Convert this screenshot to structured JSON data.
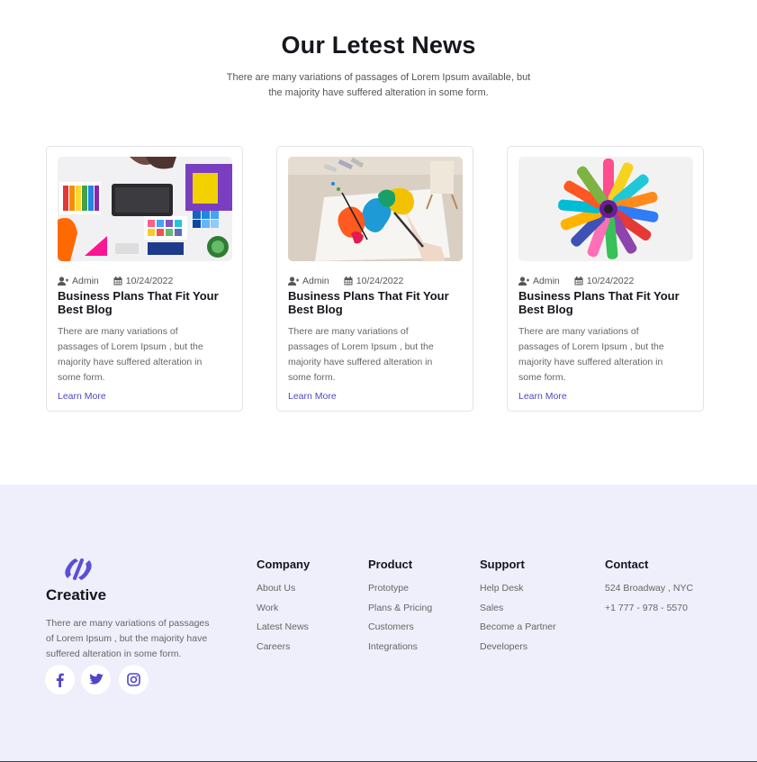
{
  "news": {
    "title": "Our Letest News",
    "subtitle": "There are many variations of passages of Lorem Ipsum available, but the majority have suffered alteration in some form."
  },
  "cards": [
    {
      "author": "Admin",
      "date": "10/24/2022",
      "title": "Business Plans That Fit Your Best Blog",
      "text": "There are many variations of passages of Lorem Ipsum , but the majority have suffered alteration in some form.",
      "link": "Learn More",
      "image": "design-desk-photo"
    },
    {
      "author": "Admin",
      "date": "10/24/2022",
      "title": "Business Plans That Fit Your Best Blog",
      "text": "There are many variations of passages of Lorem Ipsum , but the majority have suffered alteration in some form.",
      "link": "Learn More",
      "image": "painting-photo"
    },
    {
      "author": "Admin",
      "date": "10/24/2022",
      "title": "Business Plans That Fit Your Best Blog",
      "text": "There are many variations of passages of Lorem Ipsum , but the majority have suffered alteration in some form.",
      "link": "Learn More",
      "image": "markers-photo"
    }
  ],
  "footer": {
    "brand": {
      "name": "Creative",
      "text": "There are many variations of passages of Lorem Ipsum , but the majority have suffered alteration in some form."
    },
    "social": [
      "facebook-icon",
      "twitter-icon",
      "instagram-icon"
    ],
    "columns": [
      {
        "title": "Company",
        "links": [
          "About Us",
          "Work",
          "Latest News",
          "Careers"
        ]
      },
      {
        "title": "Product",
        "links": [
          "Prototype",
          "Plans & Pricing",
          "Customers",
          "Integrations"
        ]
      },
      {
        "title": "Support",
        "links": [
          "Help Desk",
          "Sales",
          "Become a Partner",
          "Developers"
        ]
      },
      {
        "title": "Contact",
        "links": [
          "524 Broadway , NYC",
          "+1 777 - 978 - 5570"
        ]
      }
    ]
  },
  "colors": {
    "accent": "#4f46c8",
    "footer_bg": "#efeefb",
    "heading": "#16161d",
    "body_text": "#666666"
  }
}
